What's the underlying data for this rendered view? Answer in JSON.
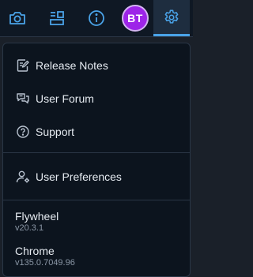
{
  "toolbar": {
    "buttons": [
      {
        "icon": "camera-icon"
      },
      {
        "icon": "layout-icon"
      },
      {
        "icon": "info-icon"
      },
      {
        "icon": "gear-icon",
        "active": true
      }
    ],
    "avatar_initials": "BT",
    "avatar_color": "#9d24e8",
    "accent_color": "#4aa3e8"
  },
  "menu": {
    "items": [
      {
        "label": "Release Notes",
        "icon": "release-notes-icon"
      },
      {
        "label": "User Forum",
        "icon": "forum-icon"
      },
      {
        "label": "Support",
        "icon": "help-icon"
      },
      {
        "label": "User Preferences",
        "icon": "user-settings-icon"
      }
    ],
    "apps": [
      {
        "name": "Flywheel",
        "version": "v20.3.1"
      },
      {
        "name": "Chrome",
        "version": "v135.0.7049.96"
      }
    ]
  }
}
